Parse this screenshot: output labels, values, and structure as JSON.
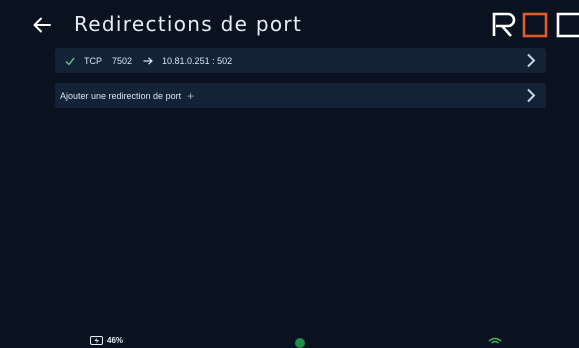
{
  "header": {
    "title": "Redirections de port",
    "logo_text": "ROC",
    "accent_color": "#e35a2a"
  },
  "redirects": [
    {
      "protocol": "TCP",
      "port": "7502",
      "target": "10.81.0.251 : 502",
      "enabled_icon": "check-icon"
    }
  ],
  "add_row": {
    "label": "Ajouter une redirection de port",
    "plus": "+"
  },
  "status": {
    "battery": "46%",
    "battery_icon": "battery-charging-icon",
    "leaf_icon": "leaf-icon",
    "wifi_icon": "wifi-icon"
  }
}
